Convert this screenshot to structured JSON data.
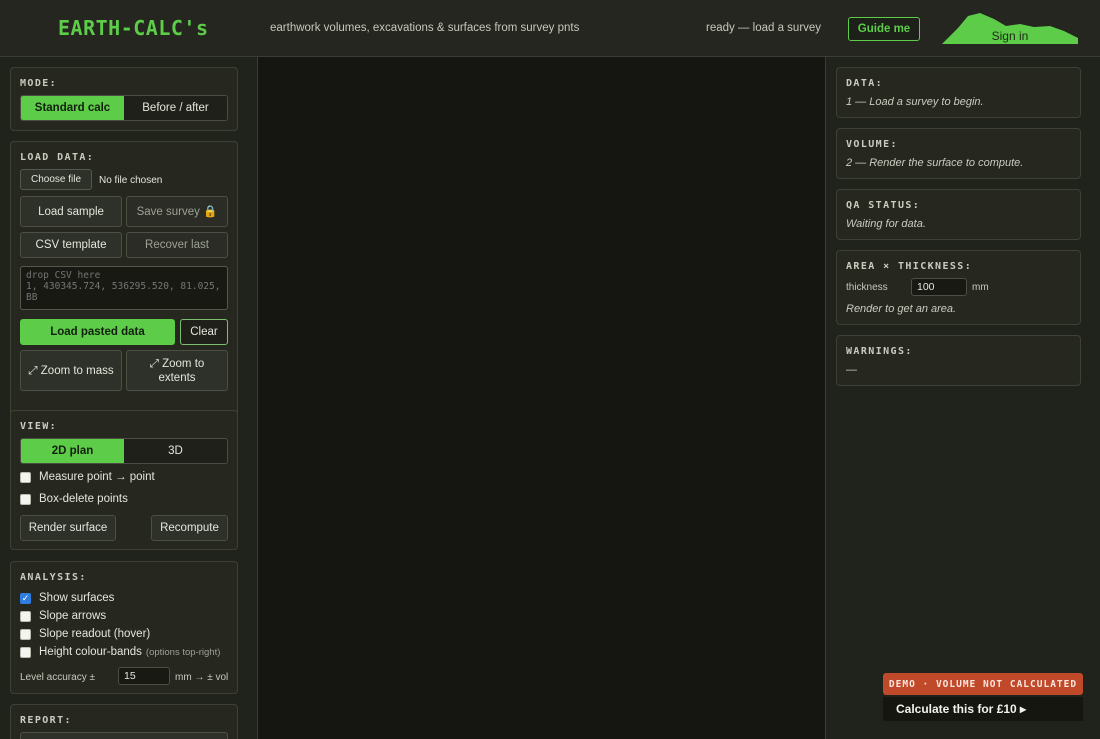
{
  "header": {
    "logo": "EARTH-CALC's",
    "tagline": "earthwork volumes, excavations & surfaces from survey pnts",
    "status": "ready — load a survey",
    "guide_label": "Guide me",
    "signin_label": "Sign in",
    "accent": "#5ccc49"
  },
  "mode": {
    "title": "MODE:",
    "options": [
      "Standard calc",
      "Before / after"
    ],
    "selected": "Standard calc"
  },
  "load": {
    "title": "LOAD DATA:",
    "choose_file": "Choose file",
    "file_status": "No file chosen",
    "load_sample": "Load sample",
    "save_survey": "Save survey 🔒",
    "csv_template": "CSV template",
    "recover_last": "Recover last",
    "paste_placeholder": "drop CSV here\n1, 430345.724, 536295.520, 81.025, BB",
    "load_pasted": "Load pasted data",
    "clear": "Clear",
    "zoom_mass": "⤢ Zoom to mass",
    "zoom_extents": "⤢ Zoom to extents"
  },
  "view": {
    "title": "VIEW:",
    "options": [
      "2D plan",
      "3D"
    ],
    "selected": "2D plan",
    "measure": "Measure point → point",
    "box_delete": "Box-delete points",
    "render": "Render surface",
    "recompute": "Recompute"
  },
  "analysis": {
    "title": "ANALYSIS:",
    "show_surfaces": "Show surfaces",
    "slope_arrows": "Slope arrows",
    "slope_readout": "Slope readout (hover)",
    "height_bands": "Height colour-bands",
    "height_bands_hint": "(options top-right)",
    "level_label": "Level accuracy ±",
    "level_value": "15",
    "level_unit": "mm → ± vol",
    "show_surfaces_checked": true
  },
  "report": {
    "title": "REPORT:"
  },
  "right": {
    "data_title": "DATA:",
    "data_text": "1 — Load a survey to begin.",
    "volume_title": "VOLUME:",
    "volume_text": "2 — Render the surface to compute.",
    "qa_title": "QA STATUS:",
    "qa_text": "Waiting for data.",
    "area_title": "AREA × THICKNESS:",
    "thickness_label": "thickness",
    "thickness_value": "100",
    "thickness_unit": "mm",
    "area_text": "Render to get an area.",
    "warnings_title": "WARNINGS:",
    "warnings_text": "—"
  },
  "demo": {
    "badge": "DEMO · VOLUME NOT CALCULATED",
    "cta": "Calculate this for £10 ▸",
    "badge_color": "#c0492a"
  }
}
